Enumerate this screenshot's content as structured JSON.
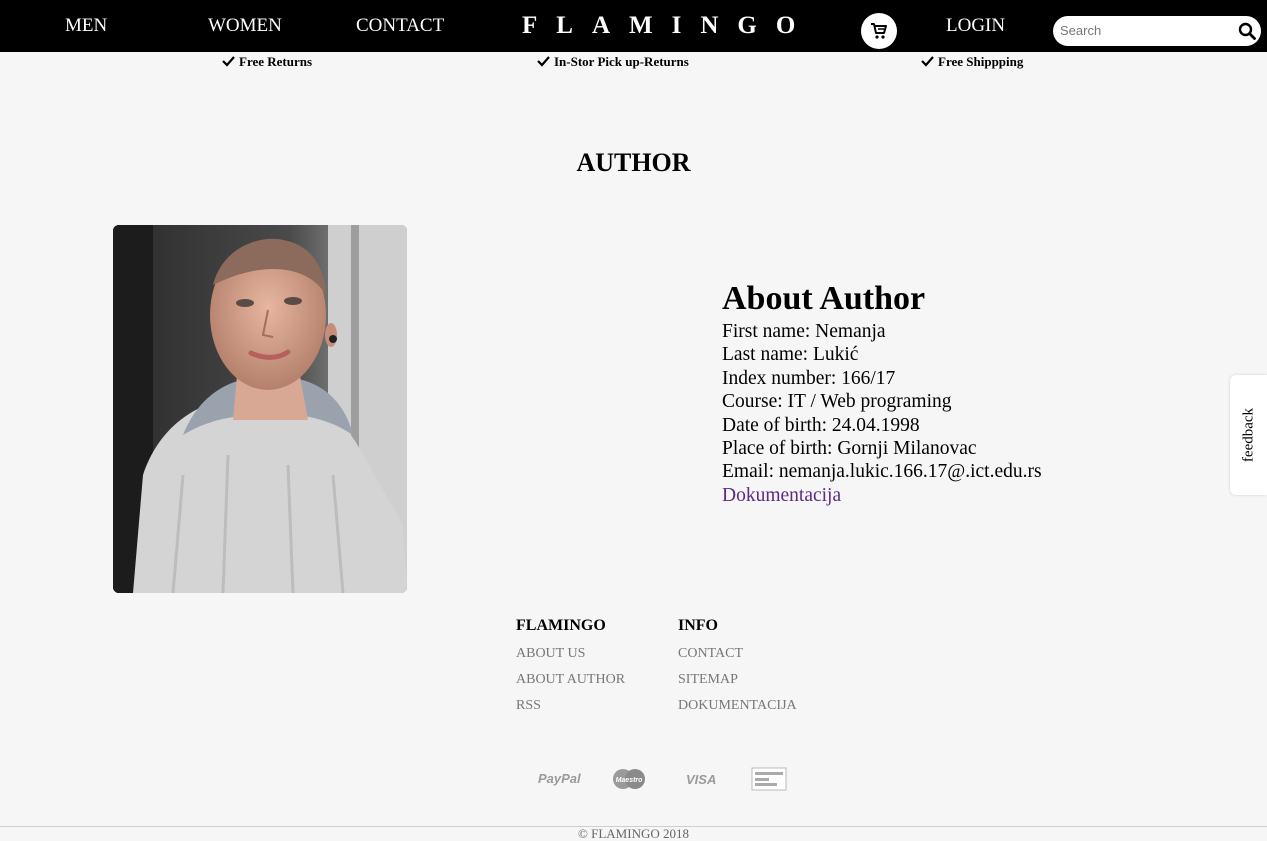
{
  "nav": {
    "men": "MEN",
    "women": "WOMEN",
    "contact": "CONTACT",
    "brand": "FLAMINGO",
    "login": "LOGIN",
    "search_placeholder": "Search",
    "cart_icon": "shopping-cart-icon",
    "search_icon": "magnifier-icon"
  },
  "perks": [
    "Free Returns",
    "In-Stor Pick up-Returns",
    "Free Shippping"
  ],
  "page": {
    "title": "AUTHOR"
  },
  "about": {
    "heading": "About Author",
    "first_name": "First name: Nemanja",
    "last_name": "Last name: Lukić",
    "index": "Index number: 166/17",
    "course": "Course: IT / Web programing",
    "dob": "Date of birth: 24.04.1998",
    "pob": "Place of birth: Gornji Milanovac",
    "email": "Email: nemanja.lukic.166.17@.ict.edu.rs",
    "doc_link": "Dokumentacija"
  },
  "feedback": "feedback",
  "footer": {
    "col1": {
      "title": "FLAMINGO",
      "links": [
        "ABOUT US",
        "ABOUT AUTHOR",
        "RSS"
      ]
    },
    "col2": {
      "title": "INFO",
      "links": [
        "CONTACT",
        "SITEMAP",
        "DOKUMENTACIJA"
      ]
    },
    "payments": {
      "paypal": "PayPal",
      "maestro": "Maestro",
      "visa": "VISA",
      "mastercard": "Mastercard"
    },
    "copyright": "© FLAMINGO 2018"
  },
  "colors": {
    "nav_bg": "#000000",
    "page_bg": "#f6f6f6",
    "link_purple": "#5b2a86",
    "footer_link": "#777777"
  }
}
